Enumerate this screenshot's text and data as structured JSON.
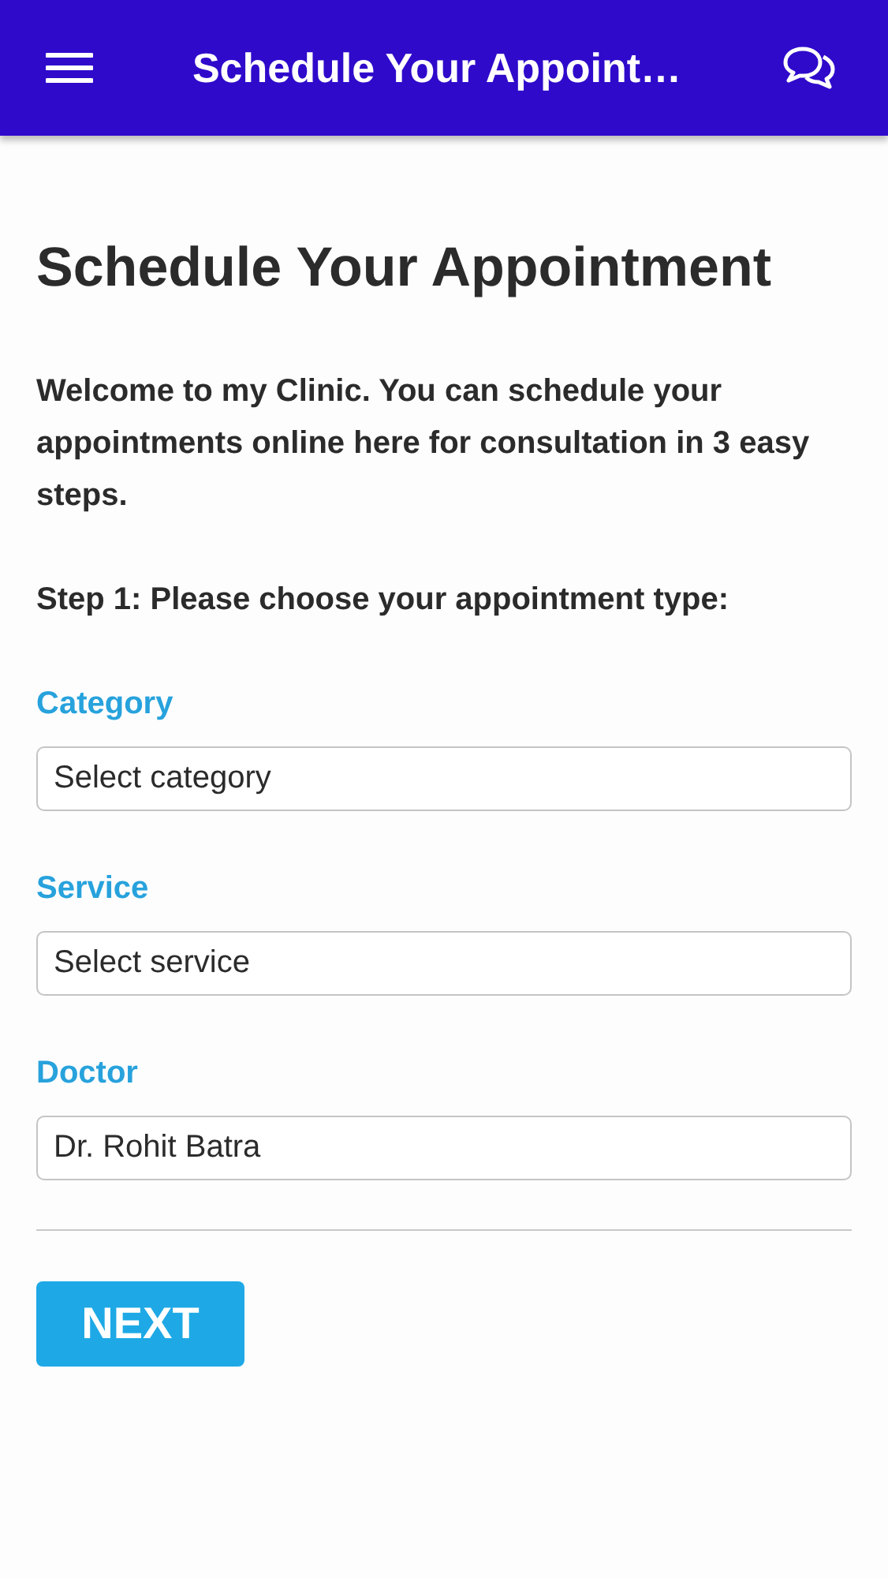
{
  "app_bar": {
    "title": "Schedule Your Appoint…"
  },
  "heading": "Schedule Your Appointment",
  "intro": "Welcome to my Clinic. You can schedule your appointments online here for consultation in 3 easy steps.",
  "step": "Step 1: Please choose your appointment type:",
  "fields": [
    {
      "label": "Category",
      "value": "Select category"
    },
    {
      "label": "Service",
      "value": "Select service"
    },
    {
      "label": "Doctor",
      "value": "Dr. Rohit Batra"
    }
  ],
  "button": "NEXT"
}
